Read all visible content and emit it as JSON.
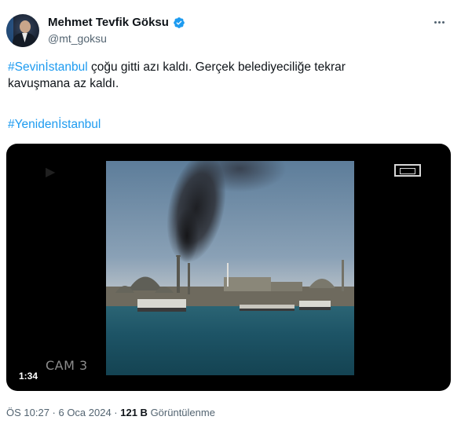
{
  "author": {
    "display_name": "Mehmet Tevfik Göksu",
    "handle": "@mt_goksu",
    "verified": true
  },
  "tweet": {
    "hashtag1": "#Sevinİstanbul",
    "text_line1_rest": " çoğu gitti azı kaldı. Gerçek belediyeciliğe tekrar",
    "text_line2": "kavuşmana az kaldı.",
    "hashtag2": "#Yenidenİstanbul"
  },
  "media": {
    "duration": "1:34",
    "cam_label": "CAM 3"
  },
  "meta": {
    "time": "ÖS 10:27 · 6 Oca 2024 · ",
    "views_count": "121 B",
    "views_label": " Görüntülenme"
  },
  "colors": {
    "accent": "#1d9bf0",
    "text": "#0f1419",
    "secondary": "#536471"
  },
  "icons": {
    "verified": "verified-badge-icon",
    "more": "more-options-icon",
    "rec": "rec-frame-icon"
  }
}
